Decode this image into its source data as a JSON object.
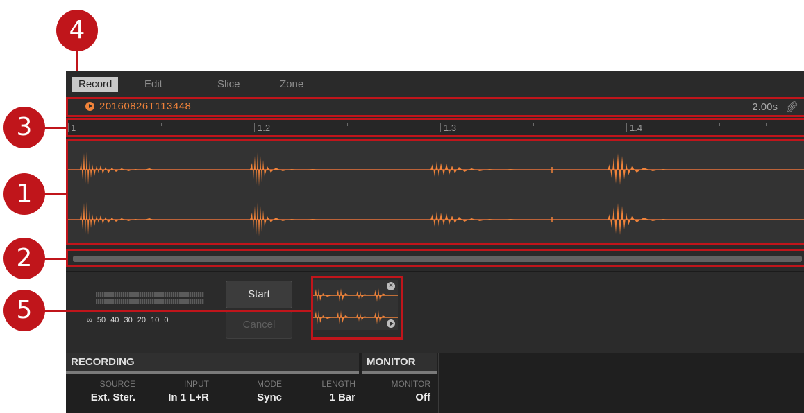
{
  "tabs": [
    {
      "label": "Record",
      "active": true
    },
    {
      "label": "Edit",
      "active": false
    },
    {
      "label": "Slice",
      "active": false
    },
    {
      "label": "Zone",
      "active": false
    }
  ],
  "sample": {
    "name": "20160826T113448",
    "duration": "2.00s"
  },
  "ruler": {
    "labels": [
      "1",
      "1.2",
      "1.3",
      "1.4"
    ]
  },
  "recorder": {
    "meter_scale": "∞ 50 40 30 20 10 0",
    "start_label": "Start",
    "cancel_label": "Cancel"
  },
  "recording": {
    "header": "RECORDING",
    "params": [
      {
        "name": "SOURCE",
        "value": "Ext. Ster."
      },
      {
        "name": "INPUT",
        "value": "In 1 L+R"
      },
      {
        "name": "MODE",
        "value": "Sync"
      },
      {
        "name": "LENGTH",
        "value": "1 Bar"
      }
    ]
  },
  "monitor": {
    "header": "MONITOR",
    "params": [
      {
        "name": "MONITOR",
        "value": "Off"
      }
    ]
  },
  "callouts": [
    "1",
    "2",
    "3",
    "4",
    "5"
  ],
  "colors": {
    "accent": "#f0833a",
    "callout": "#c0151b",
    "panel": "#2a2a2a"
  }
}
